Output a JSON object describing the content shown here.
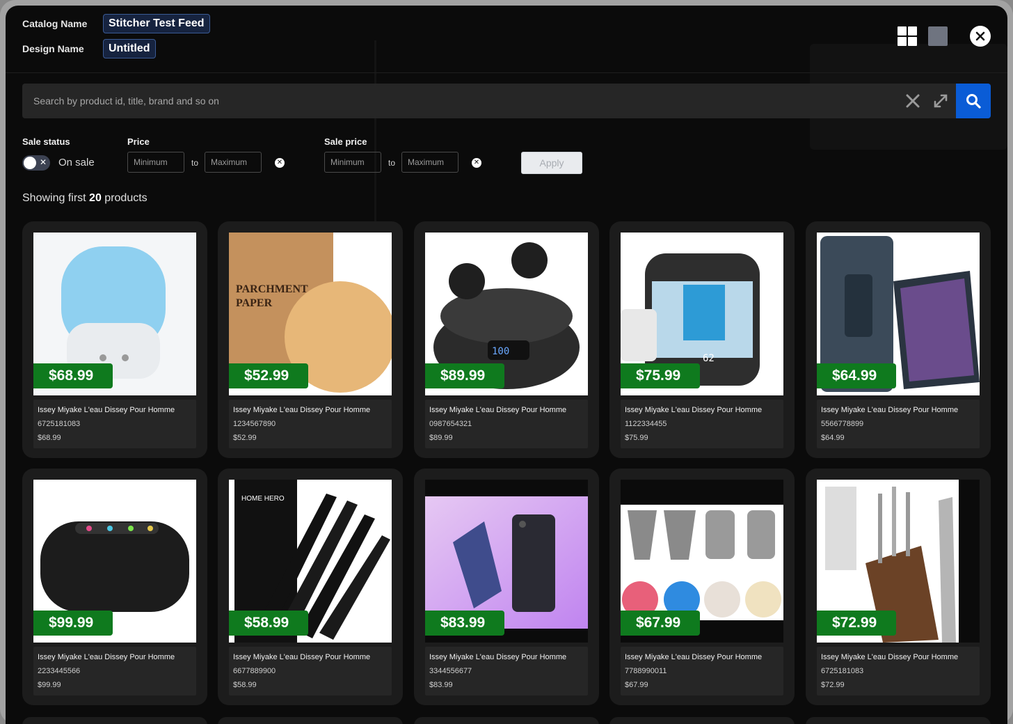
{
  "header": {
    "catalog_label": "Catalog Name",
    "catalog_value": "Stitcher Test Feed",
    "design_label": "Design Name",
    "design_value": "Untitled"
  },
  "search": {
    "placeholder": "Search by product id, title, brand and so on"
  },
  "filters": {
    "sale_status_label": "Sale status",
    "on_sale_label": "On sale",
    "price_label": "Price",
    "sale_price_label": "Sale price",
    "min_placeholder": "Minimum",
    "max_placeholder": "Maximum",
    "to": "to",
    "apply_label": "Apply"
  },
  "results": {
    "prefix": "Showing first",
    "count": "20",
    "suffix": "products"
  },
  "products": [
    {
      "name": "Issey Miyake L'eau Dissey Pour Homme",
      "id": "6725181083",
      "price": "$68.99",
      "tag": "$68.99",
      "icon": "humidifier-image"
    },
    {
      "name": "Issey Miyake L'eau Dissey Pour Homme",
      "id": "1234567890",
      "price": "$52.99",
      "tag": "$52.99",
      "icon": "parchment-paper-image"
    },
    {
      "name": "Issey Miyake L'eau Dissey Pour Homme",
      "id": "0987654321",
      "price": "$89.99",
      "tag": "$89.99",
      "icon": "earbuds-image"
    },
    {
      "name": "Issey Miyake L'eau Dissey Pour Homme",
      "id": "1122334455",
      "price": "$75.99",
      "tag": "$75.99",
      "icon": "humidifier-dreo-image"
    },
    {
      "name": "Issey Miyake L'eau Dissey Pour Homme",
      "id": "5566778899",
      "price": "$64.99",
      "tag": "$64.99",
      "icon": "tablet-case-image"
    },
    {
      "name": "Issey Miyake L'eau Dissey Pour Homme",
      "id": "2233445566",
      "price": "$99.99",
      "tag": "$99.99",
      "icon": "speaker-image"
    },
    {
      "name": "Issey Miyake L'eau Dissey Pour Homme",
      "id": "6677889900",
      "price": "$58.99",
      "tag": "$58.99",
      "icon": "knife-set-image"
    },
    {
      "name": "Issey Miyake L'eau Dissey Pour Homme",
      "id": "3344556677",
      "price": "$83.99",
      "tag": "$83.99",
      "icon": "flip-phone-image"
    },
    {
      "name": "Issey Miyake L'eau Dissey Pour Homme",
      "id": "7788990011",
      "price": "$67.99",
      "tag": "$67.99",
      "icon": "piping-tips-image"
    },
    {
      "name": "Issey Miyake L'eau Dissey Pour Homme",
      "id": "6725181083",
      "price": "$72.99",
      "tag": "$72.99",
      "icon": "knife-block-image"
    }
  ],
  "colors": {
    "accent_blue": "#0a5cd6",
    "price_green": "#0f7a1e",
    "chip_bg": "#16233f"
  }
}
